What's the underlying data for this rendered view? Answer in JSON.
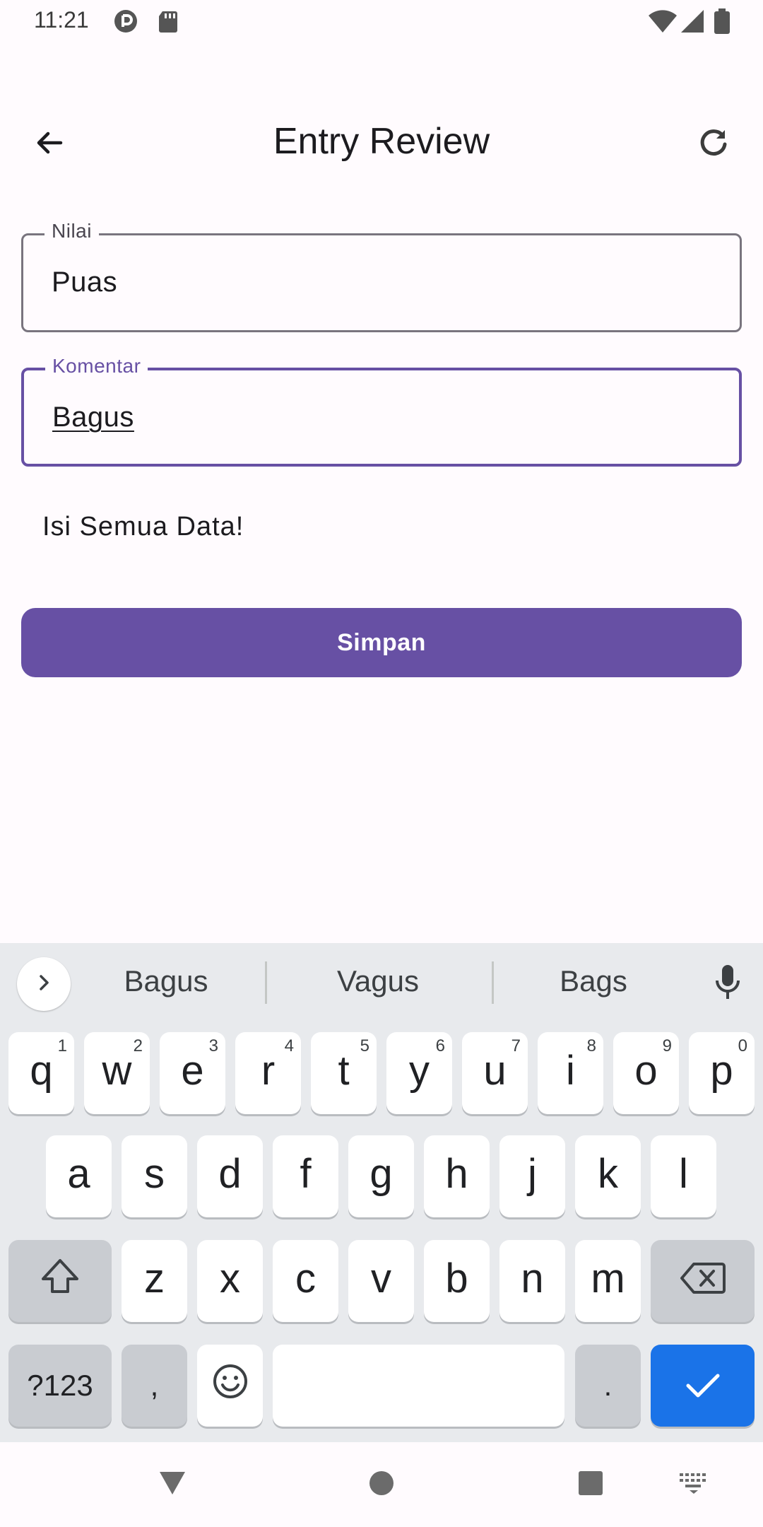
{
  "status_bar": {
    "time": "11:21"
  },
  "app_bar": {
    "title": "Entry Review"
  },
  "form": {
    "nilai": {
      "label": "Nilai",
      "value": "Puas"
    },
    "komentar": {
      "label": "Komentar",
      "value": "Bagus"
    },
    "error": "Isi Semua Data!",
    "save_label": "Simpan"
  },
  "keyboard": {
    "suggestions": [
      "Bagus",
      "Vagus",
      "Bags"
    ],
    "row1": [
      {
        "char": "q",
        "hint": "1"
      },
      {
        "char": "w",
        "hint": "2"
      },
      {
        "char": "e",
        "hint": "3"
      },
      {
        "char": "r",
        "hint": "4"
      },
      {
        "char": "t",
        "hint": "5"
      },
      {
        "char": "y",
        "hint": "6"
      },
      {
        "char": "u",
        "hint": "7"
      },
      {
        "char": "i",
        "hint": "8"
      },
      {
        "char": "o",
        "hint": "9"
      },
      {
        "char": "p",
        "hint": "0"
      }
    ],
    "row2": [
      "a",
      "s",
      "d",
      "f",
      "g",
      "h",
      "j",
      "k",
      "l"
    ],
    "row3": [
      "z",
      "x",
      "c",
      "v",
      "b",
      "n",
      "m"
    ],
    "symbols_label": "?123",
    "comma": ",",
    "period": "."
  },
  "colors": {
    "primary": "#6750a4",
    "enter_key": "#1a73e8",
    "keyboard_bg": "#e8eaed"
  },
  "icons": {
    "back": "arrow-left-icon",
    "refresh": "refresh-icon",
    "expand": "chevron-right-icon",
    "mic": "mic-icon",
    "shift": "shift-icon",
    "backspace": "backspace-icon",
    "emoji": "emoji-icon",
    "enter": "check-icon",
    "nav_back": "triangle-back-icon",
    "nav_home": "circle-home-icon",
    "nav_recents": "square-recents-icon",
    "nav_keyboard": "keyboard-icon"
  }
}
